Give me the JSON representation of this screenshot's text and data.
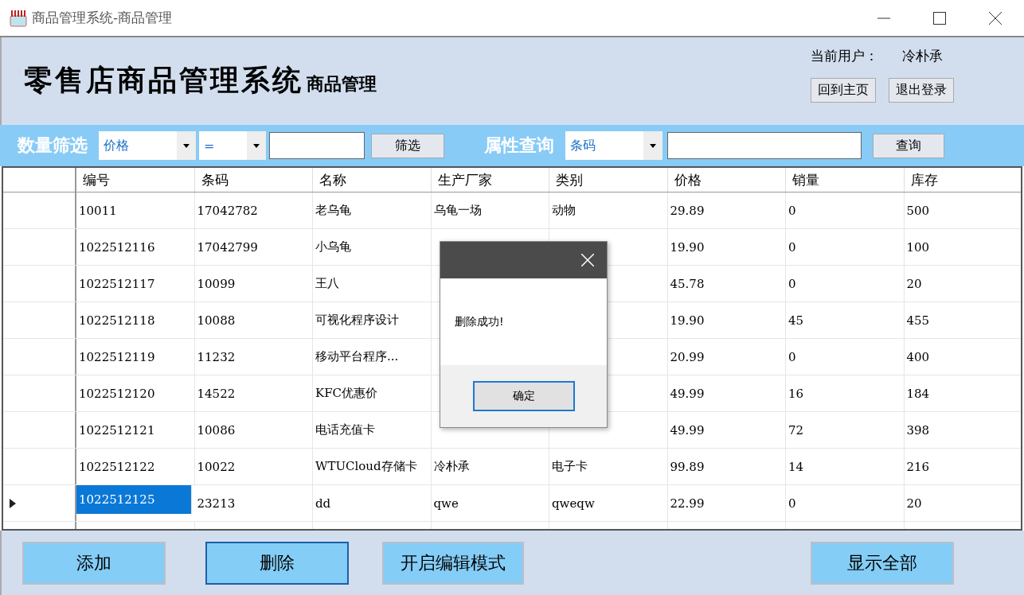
{
  "window": {
    "title": "商品管理系统-商品管理"
  },
  "header": {
    "title": "零售店商品管理系统",
    "subtitle": "商品管理",
    "user_label": "当前用户：",
    "user_name": "冷朴承",
    "buttons": [
      "回到主页",
      "退出登录"
    ]
  },
  "filter": {
    "label": "数量筛选",
    "field_select": "价格",
    "operator_select": "=",
    "button": "筛选"
  },
  "query": {
    "label": "属性查询",
    "field_select": "条码",
    "button": "查询"
  },
  "table": {
    "columns": [
      "编号",
      "条码",
      "名称",
      "生产厂家",
      "类别",
      "价格",
      "销量",
      "库存"
    ],
    "rows": [
      {
        "selected": false,
        "cells": [
          "10011",
          "17042782",
          "老乌龟",
          "乌龟一场",
          "动物",
          "29.89",
          "0",
          "500"
        ]
      },
      {
        "selected": false,
        "cells": [
          "1022512116",
          "17042799",
          "小乌龟",
          null,
          null,
          "19.90",
          "0",
          "100"
        ]
      },
      {
        "selected": false,
        "cells": [
          "1022512117",
          "10099",
          "王八",
          null,
          null,
          "45.78",
          "0",
          "20"
        ]
      },
      {
        "selected": false,
        "cells": [
          "1022512118",
          "10088",
          "可视化程序设计",
          null,
          null,
          "19.90",
          "45",
          "455"
        ]
      },
      {
        "selected": false,
        "cells": [
          "1022512119",
          "11232",
          "移动平台程序...",
          null,
          null,
          "20.99",
          "0",
          "400"
        ]
      },
      {
        "selected": false,
        "cells": [
          "1022512120",
          "14522",
          "KFC优惠价",
          null,
          null,
          "49.99",
          "16",
          "184"
        ]
      },
      {
        "selected": false,
        "cells": [
          "1022512121",
          "10086",
          "电话充值卡",
          null,
          null,
          "49.99",
          "72",
          "398"
        ]
      },
      {
        "selected": false,
        "cells": [
          "1022512122",
          "10022",
          "WTUCloud存储卡",
          "冷朴承",
          "电子卡",
          "99.89",
          "14",
          "216"
        ]
      },
      {
        "selected": true,
        "cells": [
          "1022512125",
          "23213",
          "dd",
          "qwe",
          "qweqw",
          "22.99",
          "0",
          "20"
        ]
      }
    ]
  },
  "dialog": {
    "message": "删除成功!",
    "button": "确定"
  },
  "footer_buttons": [
    {
      "label": "添加",
      "focused": false
    },
    {
      "label": "删除",
      "focused": true
    },
    {
      "label": "开启编辑模式",
      "focused": false
    },
    {
      "label": "显示全部",
      "focused": false
    }
  ]
}
